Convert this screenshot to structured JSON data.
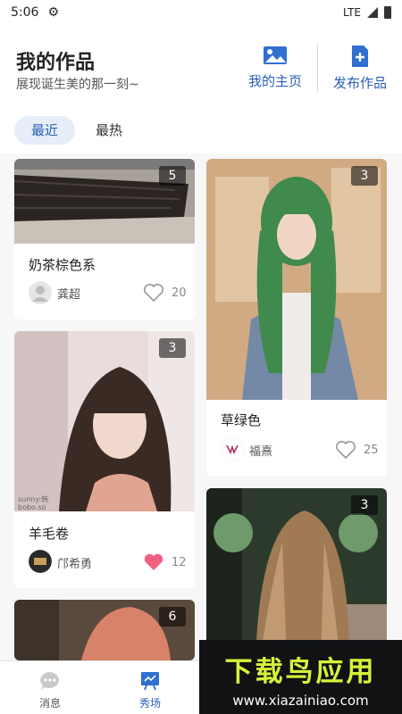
{
  "status_bar": {
    "time": "5:06",
    "network": "LTE"
  },
  "header": {
    "title": "我的作品",
    "subtitle": "展现诞生美的那一刻~",
    "home_label": "我的主页",
    "publish_label": "发布作品"
  },
  "tabs": {
    "recent": "最近",
    "hot": "最热"
  },
  "posts": [
    {
      "count": "5",
      "title": "奶茶棕色系",
      "author": "龚超",
      "likes": "20",
      "liked": false
    },
    {
      "count": "3",
      "title": "草绿色",
      "author": "福熹",
      "likes": "25",
      "liked": false
    },
    {
      "count": "3",
      "title": "羊毛卷",
      "author": "邝希勇",
      "likes": "12",
      "liked": true
    },
    {
      "count": "3"
    },
    {
      "count": "6"
    }
  ],
  "photo_overlays": {
    "post3_caption_1": "sunny:韩",
    "post3_caption_2": "bobo.so"
  },
  "bottom_nav": {
    "messages": "消息",
    "showcase": "秀场"
  },
  "watermark": {
    "brand": "下载鸟应用",
    "url": "www.xiazainiao.com"
  },
  "colors": {
    "accent": "#2a5fb3",
    "liked_heart": "#f06080",
    "watermark_green": "#d8f238"
  }
}
